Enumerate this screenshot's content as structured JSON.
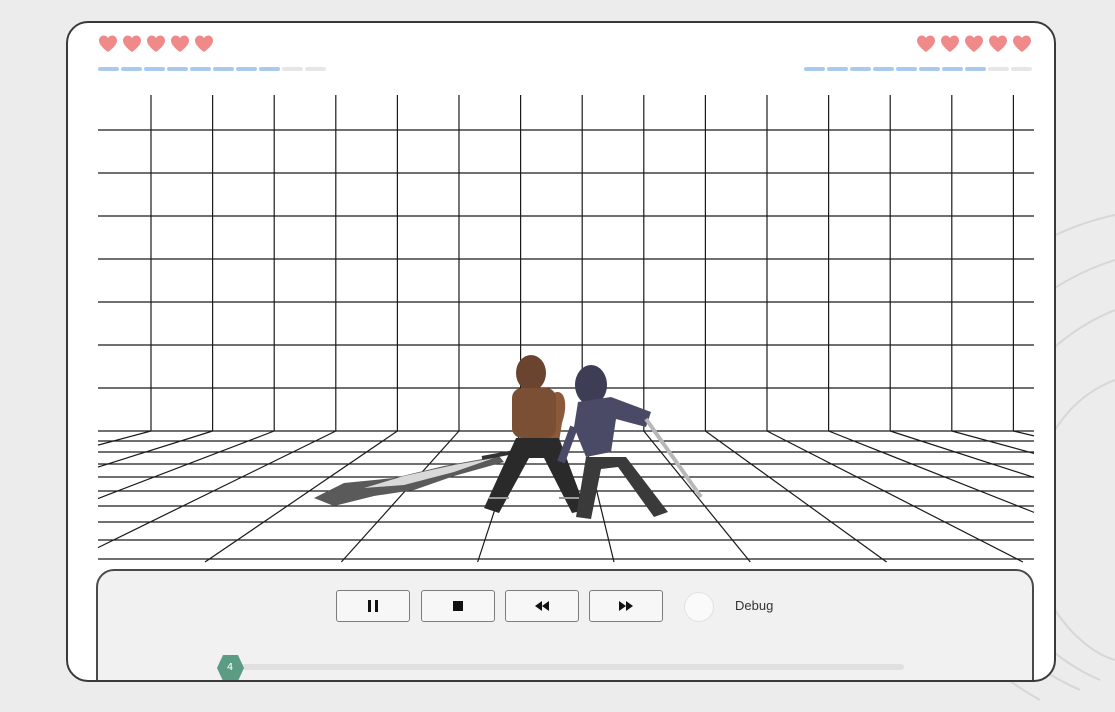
{
  "hud": {
    "player1": {
      "hearts": 5,
      "energy_segments_filled": 8,
      "energy_segments_total": 10
    },
    "player2": {
      "hearts": 5,
      "energy_segments_filled": 8,
      "energy_segments_total": 10
    }
  },
  "colors": {
    "heart": "#f08a8a",
    "energy": "#a9c9ee",
    "grid": "#1a1a1a",
    "slider_thumb": "#5d9c84"
  },
  "controls": {
    "buttons": [
      {
        "name": "pause-button",
        "icon": "pause-icon"
      },
      {
        "name": "stop-button",
        "icon": "stop-icon"
      },
      {
        "name": "rewind-button",
        "icon": "rewind-icon"
      },
      {
        "name": "fast-forward-button",
        "icon": "fast-forward-icon"
      }
    ],
    "debug_label": "Debug",
    "debug_enabled": false,
    "slider_value": "4"
  }
}
